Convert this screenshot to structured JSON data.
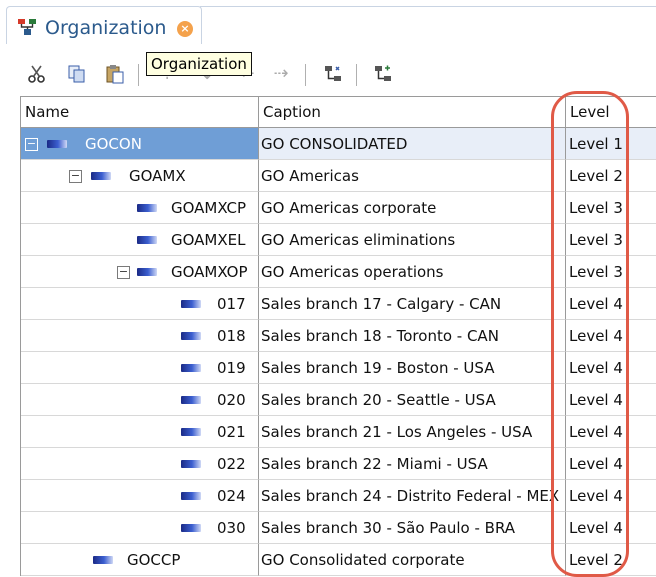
{
  "tab": {
    "title": "Organization",
    "icon": "hierarchy-icon",
    "close_icon": "close-icon"
  },
  "tooltip": {
    "text": "Organization"
  },
  "toolbar": {
    "buttons": [
      {
        "name": "cut-button",
        "icon": "scissors-icon"
      },
      {
        "name": "copy-button",
        "icon": "copy-icon"
      },
      {
        "name": "paste-button",
        "icon": "paste-icon"
      },
      {
        "name": "move-up-button",
        "icon": "move-up-icon"
      },
      {
        "name": "move-down-button",
        "icon": "move-down-icon"
      },
      {
        "name": "move-left-button",
        "icon": "move-left-icon"
      },
      {
        "name": "move-right-button",
        "icon": "move-right-icon"
      },
      {
        "name": "hierarchy-button-1",
        "icon": "hierarchy-icon"
      },
      {
        "name": "hierarchy-button-2",
        "icon": "hierarchy-icon"
      }
    ]
  },
  "grid": {
    "columns": {
      "name": "Name",
      "caption": "Caption",
      "level": "Level"
    },
    "rows": [
      {
        "name": "GOCON",
        "caption": "GO CONSOLIDATED",
        "level": "Level 1",
        "expander": "−",
        "selected": true
      },
      {
        "name": "GOAMX",
        "caption": "GO Americas",
        "level": "Level 2",
        "expander": "−"
      },
      {
        "name": "GOAMXCP",
        "caption": "GO Americas corporate",
        "level": "Level 3"
      },
      {
        "name": "GOAMXEL",
        "caption": "GO Americas eliminations",
        "level": "Level 3"
      },
      {
        "name": "GOAMXOP",
        "caption": "GO Americas operations",
        "level": "Level 3",
        "expander": "−"
      },
      {
        "name": "017",
        "caption": "Sales branch 17 - Calgary - CAN",
        "level": "Level 4"
      },
      {
        "name": "018",
        "caption": "Sales branch 18 - Toronto - CAN",
        "level": "Level 4"
      },
      {
        "name": "019",
        "caption": "Sales branch 19 - Boston - USA",
        "level": "Level 4"
      },
      {
        "name": "020",
        "caption": "Sales branch 20 - Seattle - USA",
        "level": "Level 4"
      },
      {
        "name": "021",
        "caption": "Sales branch 21 - Los Angeles - USA",
        "level": "Level 4"
      },
      {
        "name": "022",
        "caption": "Sales branch 22 - Miami - USA",
        "level": "Level 4"
      },
      {
        "name": "024",
        "caption": "Sales branch 24 - Distrito Federal - MEX",
        "level": "Level 4"
      },
      {
        "name": "030",
        "caption": "Sales branch 30 - São Paulo - BRA",
        "level": "Level 4"
      },
      {
        "name": "GOCCP",
        "caption": "GO Consolidated corporate",
        "level": "Level 2"
      }
    ]
  },
  "colors": {
    "selection": "#6f9ed6",
    "highlight_oval": "#e05a47",
    "tab_text": "#2b5a8c"
  }
}
